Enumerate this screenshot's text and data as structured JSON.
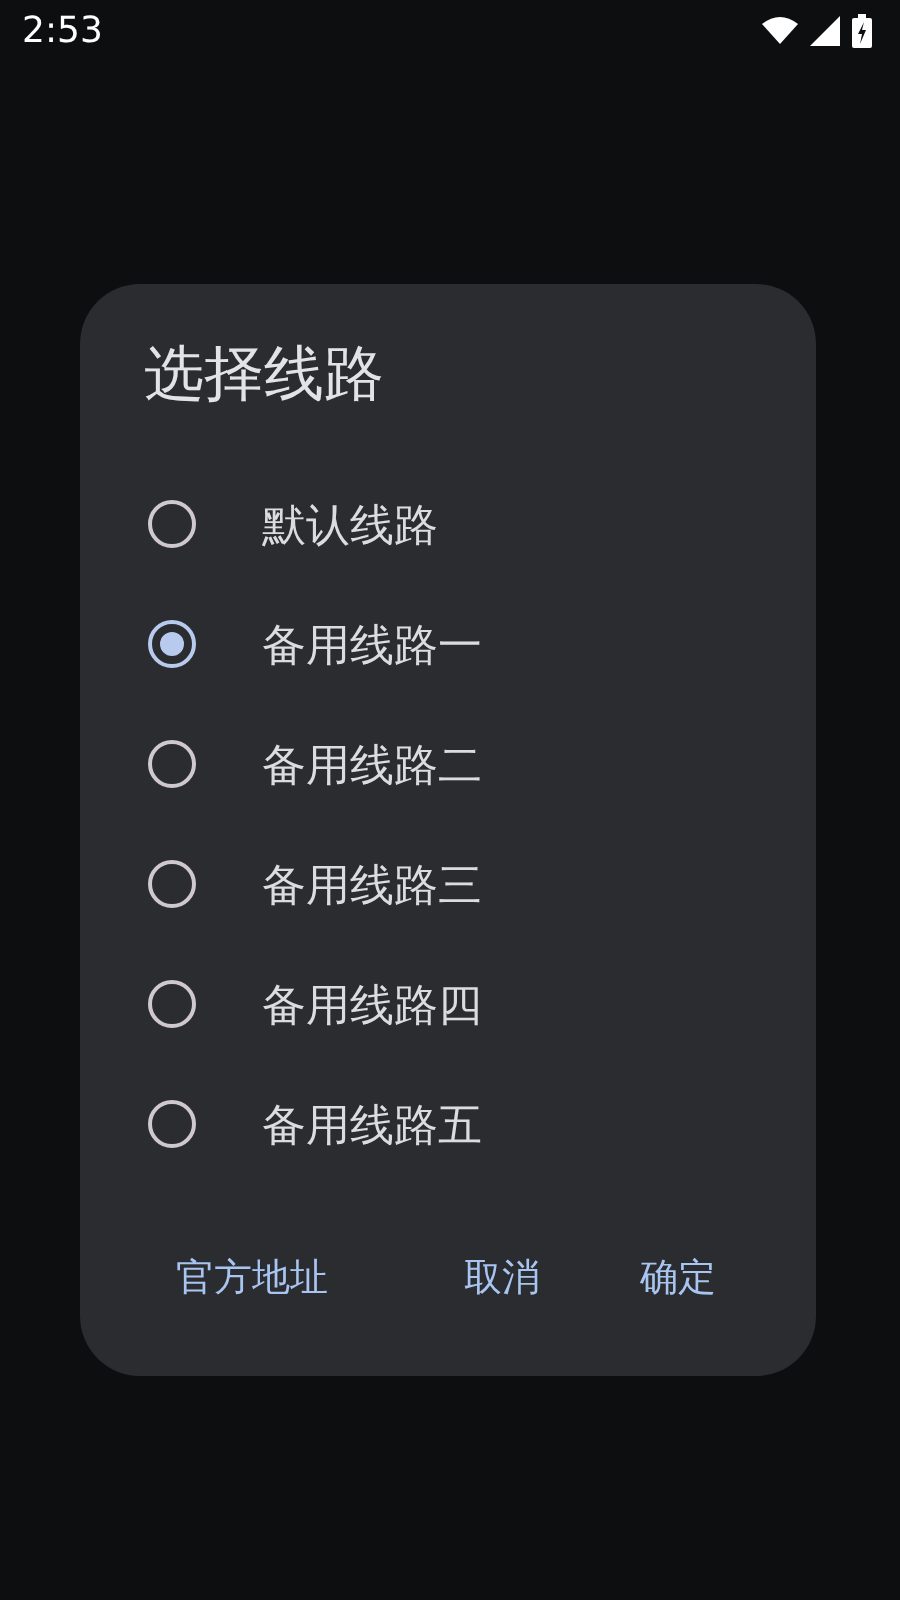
{
  "status_bar": {
    "time": "2:53"
  },
  "dialog": {
    "title": "选择线路",
    "options": [
      {
        "label": "默认线路",
        "selected": false
      },
      {
        "label": "备用线路一",
        "selected": true
      },
      {
        "label": "备用线路二",
        "selected": false
      },
      {
        "label": "备用线路三",
        "selected": false
      },
      {
        "label": "备用线路四",
        "selected": false
      },
      {
        "label": "备用线路五",
        "selected": false
      }
    ],
    "buttons": [
      "官方地址",
      "取消",
      "确定"
    ]
  }
}
